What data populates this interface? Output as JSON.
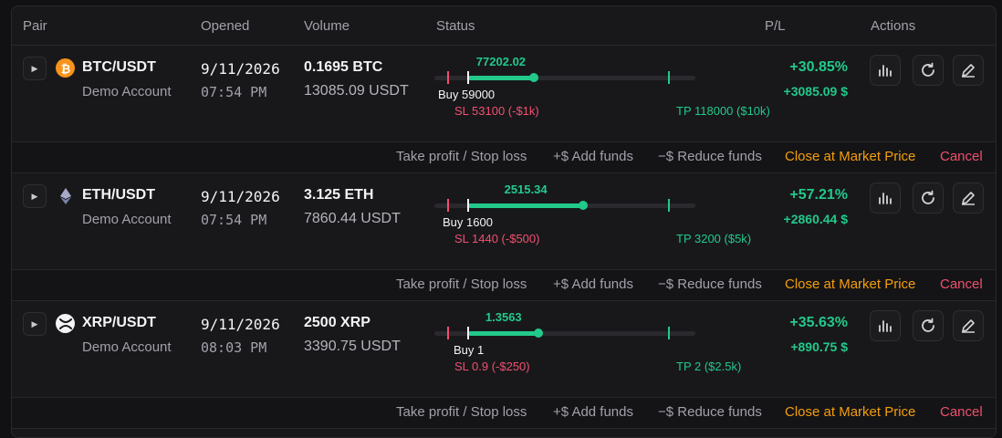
{
  "headers": {
    "pair": "Pair",
    "opened": "Opened",
    "volume": "Volume",
    "status": "Status",
    "pl": "P/L",
    "actions": "Actions"
  },
  "row_actions": {
    "tpsl": "Take profit / Stop loss",
    "add": "+$ Add funds",
    "reduce": "−$ Reduce funds",
    "close": "Close at Market Price",
    "cancel": "Cancel"
  },
  "icons": {
    "expand": "play-triangle-icon",
    "chart": "bar-chart-icon",
    "refresh": "refresh-icon",
    "edit": "pencil-icon"
  },
  "colors": {
    "profit": "#22c98a",
    "loss": "#f0506e",
    "close": "#f59e0b"
  },
  "positions": [
    {
      "pair": "BTC/USDT",
      "account": "Demo Account",
      "date": "9/11/2026",
      "time": "07:54 PM",
      "volume": "0.1695 BTC",
      "volume_usdt": "13085.09 USDT",
      "current": "77202.02",
      "buy": "Buy 59000",
      "sl": "SL 53100 (-$1k)",
      "tp": "TP 118000 ($10k)",
      "progress": 0.38,
      "entry": 0.13,
      "pl_pct": "+30.85%",
      "pl_amt": "+3085.09 $",
      "coin": "bitcoin-icon"
    },
    {
      "pair": "ETH/USDT",
      "account": "Demo Account",
      "date": "9/11/2026",
      "time": "07:54 PM",
      "volume": "3.125 ETH",
      "volume_usdt": "7860.44 USDT",
      "current": "2515.34",
      "buy": "Buy 1600",
      "sl": "SL 1440 (-$500)",
      "tp": "TP 3200 ($5k)",
      "progress": 0.57,
      "entry": 0.13,
      "pl_pct": "+57.21%",
      "pl_amt": "+2860.44 $",
      "coin": "ethereum-icon"
    },
    {
      "pair": "XRP/USDT",
      "account": "Demo Account",
      "date": "9/11/2026",
      "time": "08:03 PM",
      "volume": "2500 XRP",
      "volume_usdt": "3390.75 USDT",
      "current": "1.3563",
      "buy": "Buy 1",
      "sl": "SL 0.9 (-$250)",
      "tp": "TP 2 ($2.5k)",
      "progress": 0.4,
      "entry": 0.13,
      "pl_pct": "+35.63%",
      "pl_amt": "+890.75 $",
      "coin": "xrp-icon"
    }
  ]
}
